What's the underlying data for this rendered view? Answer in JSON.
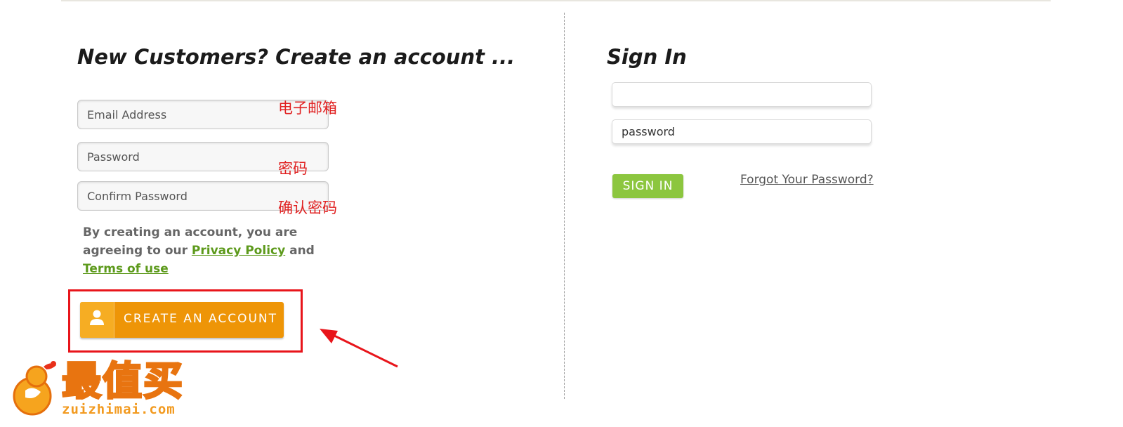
{
  "register": {
    "heading": "New Customers? Create an account ...",
    "email_placeholder": "Email Address",
    "password_placeholder": "Password",
    "confirm_placeholder": "Confirm Password",
    "agree_text": "By creating an account, you are agreeing to our",
    "privacy_link": "Privacy Policy",
    "and_text": "and",
    "terms_link": "Terms of use",
    "create_button": "CREATE AN ACCOUNT"
  },
  "annotations": {
    "email": "电子邮箱",
    "password": "密码",
    "confirm": "确认密码"
  },
  "signin": {
    "heading": "Sign In",
    "email_value": "",
    "password_placeholder": "password",
    "signin_button": "SIGN IN",
    "forgot_link": "Forgot Your Password?"
  },
  "watermark": {
    "brand": "最值买",
    "domain": "zuizhimai.com"
  },
  "colors": {
    "create_button": "#ee9507",
    "signin_button": "#8cc63f",
    "link_green": "#5d9a1c",
    "annotation_red": "#e02020"
  }
}
